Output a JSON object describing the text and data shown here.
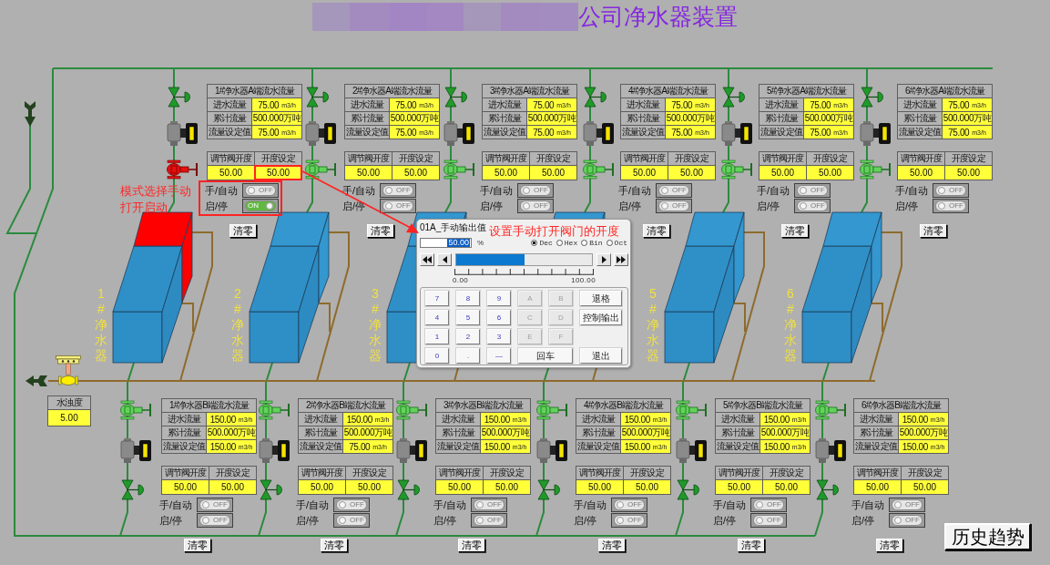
{
  "header": {
    "title": "公司净水器装置"
  },
  "purifiers": [
    {
      "label": "1#净水器",
      "running": true,
      "a_side": {
        "title": "1#净水器A端流水流量",
        "rows": [
          {
            "label": "进水流量",
            "value": "75.00",
            "unit": "m3/h"
          },
          {
            "label": "累计流量",
            "value": "500.000万吨"
          },
          {
            "label": "流量设定值",
            "value": "75.00",
            "unit": "m3/h"
          }
        ],
        "valve": {
          "headers": [
            "调节阀开度",
            "开度设定"
          ],
          "values": [
            "50.00",
            "50.00"
          ]
        },
        "switches": [
          {
            "label": "手/自动",
            "on": false,
            "text": "OFF"
          },
          {
            "label": "启/停",
            "on": true,
            "text": "ON"
          }
        ],
        "reset": "清零"
      },
      "b_side": {
        "title": "1#净水器B端流水流量",
        "rows": [
          {
            "label": "进水流量",
            "value": "150.00",
            "unit": "m3/h"
          },
          {
            "label": "累计流量",
            "value": "500.000万吨"
          },
          {
            "label": "流量设定值",
            "value": "150.00",
            "unit": "m3/h"
          }
        ],
        "valve": {
          "headers": [
            "调节阀开度",
            "开度设定"
          ],
          "values": [
            "50.00",
            "50.00"
          ]
        },
        "switches": [
          {
            "label": "手/自动",
            "on": false,
            "text": "OFF"
          },
          {
            "label": "启/停",
            "on": false,
            "text": "OFF"
          }
        ],
        "reset": "清零"
      }
    },
    {
      "label": "2#净水器",
      "running": false,
      "a_side": {
        "title": "2#净水器A端流水流量",
        "rows": [
          {
            "label": "进水流量",
            "value": "75.00",
            "unit": "m3/h"
          },
          {
            "label": "累计流量",
            "value": "500.000万吨"
          },
          {
            "label": "流量设定值",
            "value": "75.00",
            "unit": "m3/h"
          }
        ],
        "valve": {
          "headers": [
            "调节阀开度",
            "开度设定"
          ],
          "values": [
            "50.00",
            "50.00"
          ]
        },
        "switches": [
          {
            "label": "手/自动",
            "on": false,
            "text": "OFF"
          },
          {
            "label": "启/停",
            "on": false,
            "text": "OFF"
          }
        ],
        "reset": "清零"
      },
      "b_side": {
        "title": "2#净水器B端流水流量",
        "rows": [
          {
            "label": "进水流量",
            "value": "150.00",
            "unit": "m3/h"
          },
          {
            "label": "累计流量",
            "value": "500.000万吨"
          },
          {
            "label": "流量设定值",
            "value": "75.00",
            "unit": "m3/h"
          }
        ],
        "valve": {
          "headers": [
            "调节阀开度",
            "开度设定"
          ],
          "values": [
            "50.00",
            "50.00"
          ]
        },
        "switches": [
          {
            "label": "手/自动",
            "on": false,
            "text": "OFF"
          },
          {
            "label": "启/停",
            "on": false,
            "text": "OFF"
          }
        ],
        "reset": "清零"
      }
    },
    {
      "label": "3#净水器",
      "running": false,
      "a_side": {
        "title": "3#净水器A端流水流量",
        "rows": [
          {
            "label": "进水流量",
            "value": "75.00",
            "unit": "m3/h"
          },
          {
            "label": "累计流量",
            "value": "500.000万吨"
          },
          {
            "label": "流量设定值",
            "value": "75.00",
            "unit": "m3/h"
          }
        ],
        "valve": {
          "headers": [
            "调节阀开度",
            "开度设定"
          ],
          "values": [
            "50.00",
            "50.00"
          ]
        },
        "switches": [
          {
            "label": "手/自动",
            "on": false,
            "text": "OFF"
          },
          {
            "label": "启/停",
            "on": false,
            "text": "OFF"
          }
        ]
      },
      "b_side": {
        "title": "3#净水器B端流水流量",
        "rows": [
          {
            "label": "进水流量",
            "value": "150.00",
            "unit": "m3/h"
          },
          {
            "label": "累计流量",
            "value": "500.000万吨"
          },
          {
            "label": "流量设定值",
            "value": "150.00",
            "unit": "m3/h"
          }
        ],
        "valve": {
          "headers": [
            "调节阀开度",
            "开度设定"
          ],
          "values": [
            "50.00",
            "50.00"
          ]
        },
        "switches": [
          {
            "label": "手/自动",
            "on": false,
            "text": "OFF"
          },
          {
            "label": "启/停",
            "on": false,
            "text": "OFF"
          }
        ],
        "reset": "清零"
      }
    },
    {
      "running": false,
      "a_side": {
        "title": "4#净水器A端流水流量",
        "rows": [
          {
            "label": "进水流量",
            "value": "75.00",
            "unit": "m3/h"
          },
          {
            "label": "累计流量",
            "value": "500.000万吨"
          },
          {
            "label": "流量设定值",
            "value": "75.00",
            "unit": "m3/h"
          }
        ],
        "valve": {
          "headers": [
            "调节阀开度",
            "开度设定"
          ],
          "values": [
            "50.00",
            "50.00"
          ]
        },
        "switches": [
          {
            "label": "手/自动",
            "on": false,
            "text": "OFF"
          },
          {
            "label": "启/停",
            "on": false,
            "text": "OFF"
          }
        ],
        "reset": "清零"
      },
      "b_side": {
        "title": "4#净水器B端流水流量",
        "rows": [
          {
            "label": "进水流量",
            "value": "150.00",
            "unit": "m3/h"
          },
          {
            "label": "累计流量",
            "value": "500.000万吨"
          },
          {
            "label": "流量设定值",
            "value": "150.00",
            "unit": "m3/h"
          }
        ],
        "valve": {
          "headers": [
            "调节阀开度",
            "开度设定"
          ],
          "values": [
            "50.00",
            "50.00"
          ]
        },
        "switches": [
          {
            "label": "手/自动",
            "on": false,
            "text": "OFF"
          },
          {
            "label": "启/停",
            "on": false,
            "text": "OFF"
          }
        ],
        "reset": "清零"
      }
    },
    {
      "label": "5#净水器",
      "running": false,
      "a_side": {
        "title": "5#净水器A端流水流量",
        "rows": [
          {
            "label": "进水流量",
            "value": "75.00",
            "unit": "m3/h"
          },
          {
            "label": "累计流量",
            "value": "500.000万吨"
          },
          {
            "label": "流量设定值",
            "value": "75.00",
            "unit": "m3/h"
          }
        ],
        "valve": {
          "headers": [
            "调节阀开度",
            "开度设定"
          ],
          "values": [
            "50.00",
            "50.00"
          ]
        },
        "switches": [
          {
            "label": "手/自动",
            "on": false,
            "text": "OFF"
          },
          {
            "label": "启/停",
            "on": false,
            "text": "OFF"
          }
        ],
        "reset": "清零"
      },
      "b_side": {
        "title": "5#净水器B端流水流量",
        "rows": [
          {
            "label": "进水流量",
            "value": "150.00",
            "unit": "m3/h"
          },
          {
            "label": "累计流量",
            "value": "500.000万吨"
          },
          {
            "label": "流量设定值",
            "value": "150.00",
            "unit": "m3/h"
          }
        ],
        "valve": {
          "headers": [
            "调节阀开度",
            "开度设定"
          ],
          "values": [
            "50.00",
            "50.00"
          ]
        },
        "switches": [
          {
            "label": "手/自动",
            "on": false,
            "text": "OFF"
          },
          {
            "label": "启/停",
            "on": false,
            "text": "OFF"
          }
        ],
        "reset": "清零"
      }
    },
    {
      "label": "6#净水器",
      "running": false,
      "a_side": {
        "title": "6#净水器A端流水流量",
        "rows": [
          {
            "label": "进水流量",
            "value": "75.00",
            "unit": "m3/h"
          },
          {
            "label": "累计流量",
            "value": "500.000万吨"
          },
          {
            "label": "流量设定值",
            "value": "75.00",
            "unit": "m3/h"
          }
        ],
        "valve": {
          "headers": [
            "调节阀开度",
            "开度设定"
          ],
          "values": [
            "50.00",
            "50.00"
          ]
        },
        "switches": [
          {
            "label": "手/自动",
            "on": false,
            "text": "OFF"
          },
          {
            "label": "启/停",
            "on": false,
            "text": "OFF"
          }
        ],
        "reset": "清零"
      },
      "b_side": {
        "title": "6#净水器B端流水流量",
        "rows": [
          {
            "label": "进水流量",
            "value": "150.00",
            "unit": "m3/h"
          },
          {
            "label": "累计流量",
            "value": "500.000万吨"
          },
          {
            "label": "流量设定值",
            "value": "150.00",
            "unit": "m3/h"
          }
        ],
        "valve": {
          "headers": [
            "调节阀开度",
            "开度设定"
          ],
          "values": [
            "50.00",
            "50.00"
          ]
        },
        "switches": [
          {
            "label": "手/自动",
            "on": false,
            "text": "OFF"
          },
          {
            "label": "启/停",
            "on": false,
            "text": "OFF"
          }
        ],
        "reset": "清零"
      }
    }
  ],
  "turbidity": {
    "label": "水浊度",
    "value": "5.00"
  },
  "annotations": [
    {
      "text": "模式选择手动打开启动"
    },
    {
      "text": "设置手动打开阀门的开度"
    }
  ],
  "dialog": {
    "title": "01A_手动输出值",
    "input": {
      "value": "50.00"
    },
    "unit": "%",
    "radios": [
      {
        "label": "Dec",
        "selected": true
      },
      {
        "label": "Hex",
        "selected": false
      },
      {
        "label": "Bin",
        "selected": false
      },
      {
        "label": "Oct",
        "selected": false
      }
    ],
    "slider": {
      "level": 0.5,
      "min_label": "0.00",
      "max_label": "100.00"
    },
    "keypad": {
      "keys": [
        [
          {
            "label": "7",
            "kind": "digit",
            "disabled": false
          },
          {
            "label": "8",
            "kind": "digit",
            "disabled": false
          },
          {
            "label": "9",
            "kind": "digit",
            "disabled": false
          },
          {
            "label": "A",
            "kind": "digit",
            "disabled": true
          },
          {
            "label": "B",
            "kind": "digit",
            "disabled": true
          }
        ],
        [
          {
            "label": "4",
            "kind": "digit",
            "disabled": false
          },
          {
            "label": "5",
            "kind": "digit",
            "disabled": false
          },
          {
            "label": "6",
            "kind": "digit",
            "disabled": false
          },
          {
            "label": "C",
            "kind": "digit",
            "disabled": true
          },
          {
            "label": "D",
            "kind": "digit",
            "disabled": true
          }
        ],
        [
          {
            "label": "1",
            "kind": "digit",
            "disabled": false
          },
          {
            "label": "2",
            "kind": "digit",
            "disabled": false
          },
          {
            "label": "3",
            "kind": "digit",
            "disabled": false
          },
          {
            "label": "E",
            "kind": "digit",
            "disabled": true
          },
          {
            "label": "F",
            "kind": "digit",
            "disabled": true
          }
        ],
        [
          {
            "label": "0",
            "kind": "digit",
            "disabled": false
          },
          {
            "label": ".",
            "kind": "digit",
            "disabled": false
          },
          {
            "label": "—",
            "kind": "digit",
            "disabled": false
          },
          {
            "label": "回车",
            "kind": "enter",
            "disabled": false
          }
        ]
      ],
      "commands": [
        {
          "label": "退格",
          "disabled": false
        },
        {
          "label": "控制输出",
          "disabled": false
        },
        {
          "label": "退出",
          "disabled": false
        }
      ]
    }
  },
  "history_button": {
    "label": "历史趋势"
  }
}
